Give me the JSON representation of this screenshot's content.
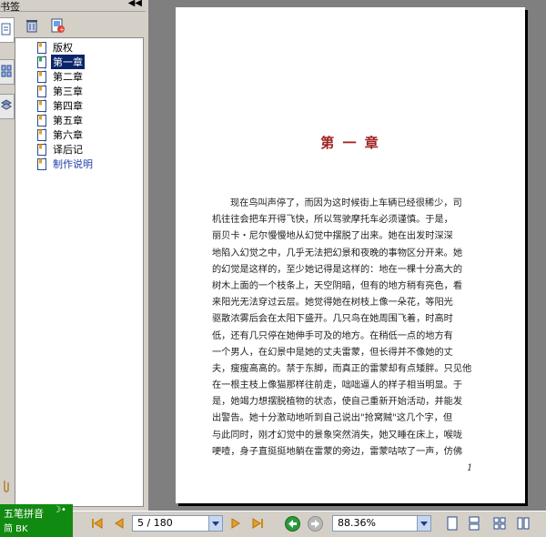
{
  "sidebar": {
    "title": "书签",
    "collapse_icon": "double-left-arrow-icon",
    "bookmarks": [
      {
        "label": "版权",
        "selected": false
      },
      {
        "label": "第一章",
        "selected": true
      },
      {
        "label": "第二章",
        "selected": false
      },
      {
        "label": "第三章",
        "selected": false
      },
      {
        "label": "第四章",
        "selected": false
      },
      {
        "label": "第五章",
        "selected": false
      },
      {
        "label": "第六章",
        "selected": false
      },
      {
        "label": "译后记",
        "selected": false
      },
      {
        "label": "制作说明",
        "selected": false
      }
    ]
  },
  "document": {
    "chapter_title": "第 一 章",
    "paragraph_lines": [
      "现在鸟叫声停了，而因为这时候街上车辆已经很稀少，司",
      "机往往会把车开得飞快，所以驾驶摩托车必须谨慎。于是，",
      "丽贝卡・尼尔慢慢地从幻觉中摆脱了出来。她在出发时深深",
      "地陷入幻觉之中，几乎无法把幻景和夜晚的事物区分开来。她",
      "的幻觉是这样的，至少她记得是这样的：地在一棵十分高大的",
      "树木上面的一个枝条上，天空阴暗，但有的地方稍有亮色，看",
      "来阳光无法穿过云层。她觉得她在树枝上像一朵花，等阳光",
      "驱散浓雾后会在太阳下盛开。几只鸟在她周围飞着，时高时",
      "低，还有几只停在她伸手可及的地方。在稍低一点的地方有",
      "一个男人，在幻景中是她的丈夫雷蒙，但长得并不像她的丈",
      "夫，瘦瘦高高的。禁于东脚，而真正的雷蒙却有点矮胖。只见他",
      "在一根主枝上像猫那样往前走，咄咄逼人的样子相当明显。于",
      "是，她竭力想摆脱植物的状态，使自己重新开始活动，并能发",
      "出警告。她十分激动地听到自己说出\"抢窝贼\"这几个字，但",
      "与此同时，刚才幻觉中的景象突然消失，她又睡在床上，喉咙",
      "哽噎，身子直挺挺地躺在雷蒙的旁边，雷蒙咕哝了一声，仿佛"
    ],
    "page_number": "1"
  },
  "statusbar": {
    "ime_name": "五笔拼音",
    "ime_mode": "简 BK",
    "page_display": "5 / 180",
    "zoom": "88.36%"
  },
  "colors": {
    "chrome": "#d4d0c8",
    "selection": "#0a246a",
    "chapter_title": "#a02222",
    "ime_bar": "#118a11",
    "doc_background": "#7f7f7f"
  }
}
